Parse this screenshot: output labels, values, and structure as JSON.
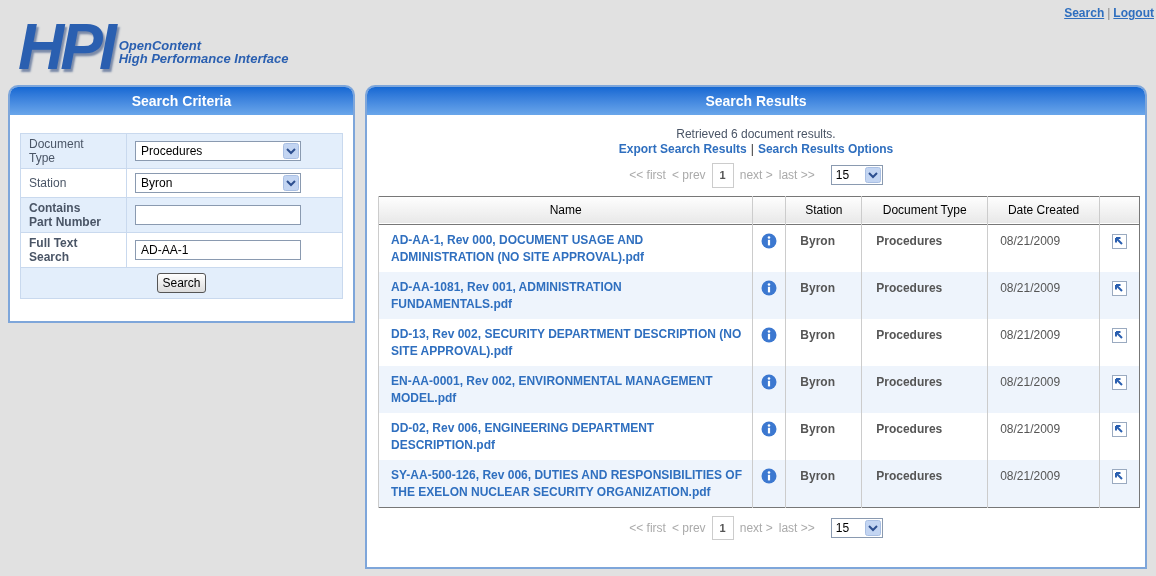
{
  "logo": {
    "mark": "HPI",
    "line_1": "OpenContent",
    "line_2": "High Performance Interface"
  },
  "top_links": [
    "Search",
    "Logout"
  ],
  "top_links_separator": "|",
  "search_criteria": {
    "title": "Search Criteria",
    "fields": [
      {
        "kind": "select",
        "label": "Document Type",
        "value": "Procedures"
      },
      {
        "kind": "select",
        "label": "Station",
        "value": "Byron"
      },
      {
        "kind": "text",
        "label": "Contains Part Number"
      },
      {
        "kind": "text",
        "label": "Full Text Search",
        "value": "AD-AA-1"
      }
    ],
    "button": "Search"
  },
  "search_results": {
    "title": "Search Results",
    "summary": "Retrieved 6 document results.",
    "links": [
      "Export Search Results",
      "Search Results Options"
    ],
    "links_separator": "|",
    "pagers": [
      {
        "first": "<< first",
        "prev": "< prev",
        "page": "1",
        "next": "next >",
        "last": "last >>",
        "disabled": true,
        "page_size": "15"
      },
      {
        "first": "<< first",
        "prev": "< prev",
        "page": "1",
        "next": "next >",
        "last": "last >>",
        "disabled": true,
        "page_size": "15"
      }
    ],
    "table": {
      "columns": [
        "Name",
        "",
        "Station",
        "Document Type",
        "Date Created",
        ""
      ],
      "rows": [
        {
          "name": "AD-AA-1, Rev 000, DOCUMENT USAGE AND ADMINISTRATION (NO SITE APPROVAL).pdf",
          "station": "Byron",
          "document_type": "Procedures",
          "date_created": "08/21/2009"
        },
        {
          "name": "AD-AA-1081, Rev 001, ADMINISTRATION FUNDAMENTALS.pdf",
          "station": "Byron",
          "document_type": "Procedures",
          "date_created": "08/21/2009"
        },
        {
          "name": "DD-13, Rev 002, SECURITY DEPARTMENT DESCRIPTION (NO SITE APPROVAL).pdf",
          "station": "Byron",
          "document_type": "Procedures",
          "date_created": "08/21/2009"
        },
        {
          "name": "EN-AA-0001, Rev 002, ENVIRONMENTAL MANAGEMENT MODEL.pdf",
          "station": "Byron",
          "document_type": "Procedures",
          "date_created": "08/21/2009"
        },
        {
          "name": "DD-02, Rev 006, ENGINEERING DEPARTMENT DESCRIPTION.pdf",
          "station": "Byron",
          "document_type": "Procedures",
          "date_created": "08/21/2009"
        },
        {
          "name": "SY-AA-500-126, Rev 006, DUTIES AND RESPONSIBILITIES OF THE EXELON NUCLEAR SECURITY ORGANIZATION.pdf",
          "station": "Byron",
          "document_type": "Procedures",
          "date_created": "08/21/2009"
        }
      ]
    }
  }
}
